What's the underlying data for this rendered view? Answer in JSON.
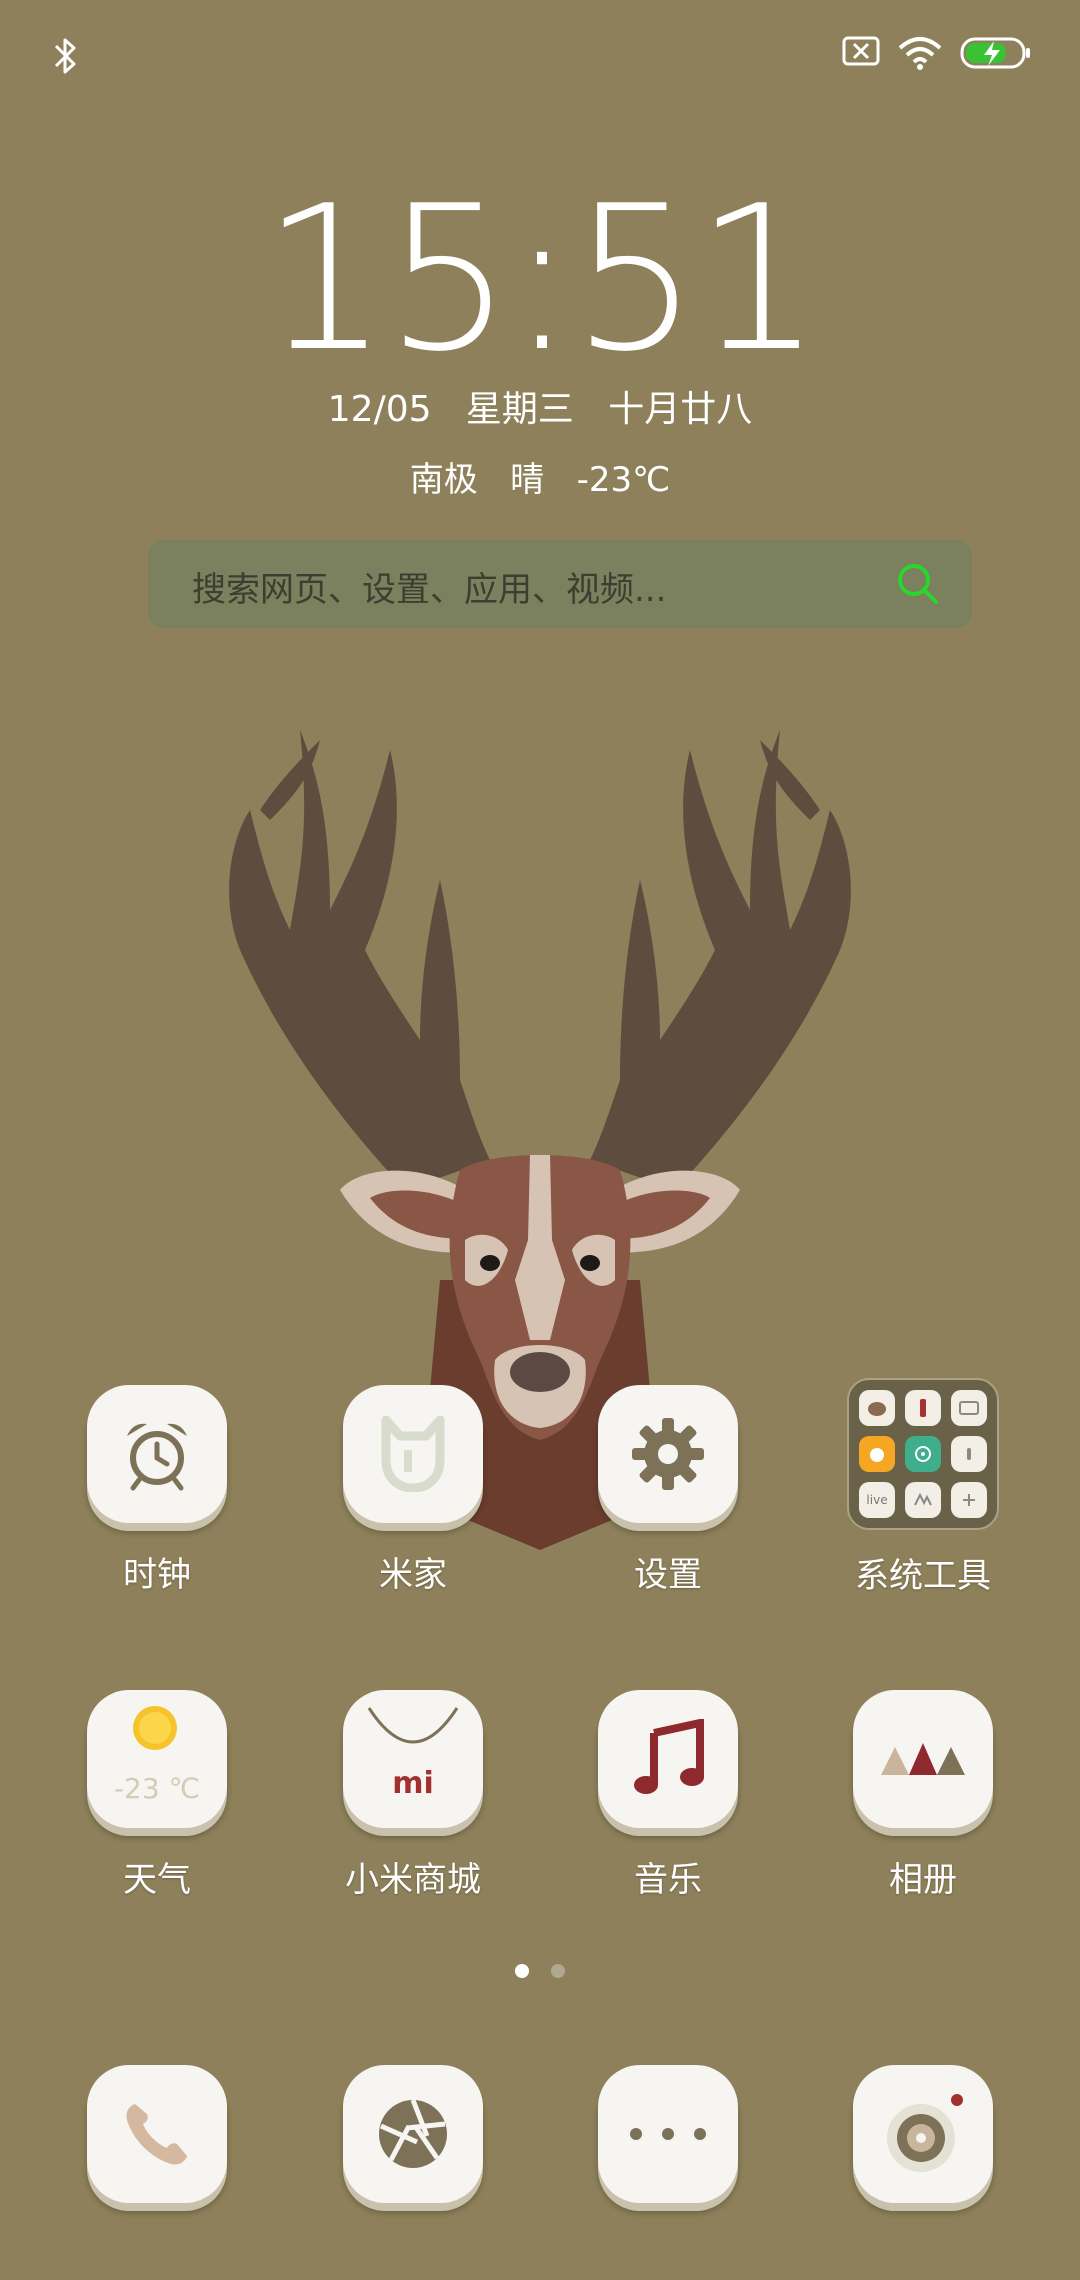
{
  "status_bar": {
    "icons": [
      "bluetooth-icon",
      "sim-error-icon",
      "wifi-icon",
      "battery-charging-icon"
    ]
  },
  "lock": {
    "time": "15:51",
    "date": "12/05",
    "weekday": "星期三",
    "lunar_date": "十月廿八",
    "location": "南极",
    "condition": "晴",
    "temperature": "-23℃"
  },
  "search": {
    "placeholder": "搜索网页、设置、应用、视频..."
  },
  "apps_row1": [
    {
      "label": "时钟",
      "icon": "alarm-clock-icon"
    },
    {
      "label": "米家",
      "icon": "mijia-icon"
    },
    {
      "label": "设置",
      "icon": "gear-icon"
    },
    {
      "label": "系统工具",
      "icon": "folder-icon"
    }
  ],
  "folder_minis": [
    "",
    "",
    "",
    "",
    "",
    "",
    "live",
    "",
    ""
  ],
  "apps_row2": [
    {
      "label": "天气",
      "icon": "weather-sun-icon",
      "temp": "-23 ℃"
    },
    {
      "label": "小米商城",
      "icon": "mi-store-icon",
      "logo": "mi"
    },
    {
      "label": "音乐",
      "icon": "music-note-icon"
    },
    {
      "label": "相册",
      "icon": "gallery-icon"
    }
  ],
  "dock": [
    {
      "icon": "phone-icon"
    },
    {
      "icon": "aperture-icon"
    },
    {
      "icon": "more-dots-icon"
    },
    {
      "icon": "camera-icon"
    }
  ],
  "page_indicator": {
    "pages": 2,
    "current": 1
  },
  "colors": {
    "wallpaper": "#8d805a",
    "search_accent": "#2bd62b",
    "battery_charge": "#39c234"
  }
}
